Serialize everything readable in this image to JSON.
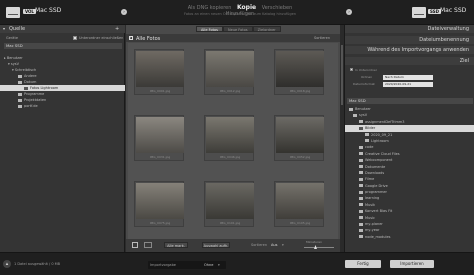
{
  "topbar": {
    "source_badge": "VOL",
    "source_drive": "Mac SSD",
    "dest_badge": "SSD",
    "dest_drive": "Mac SSD",
    "modes": [
      "Als DNG kopieren",
      "Kopie",
      "Verschieben",
      "Hinzufügen"
    ],
    "active_mode": "Kopie",
    "subtitle": "Fotos an einen neuen Ort kopieren und zum Katalog hinzufügen"
  },
  "left_panel": {
    "header": "Quelle",
    "option_label": "Geräte",
    "option_check": "Unterordner einschließen",
    "drive": "Mac SSD",
    "tree": [
      "Benutzer",
      "sysV",
      "Schreibtisch",
      "Andere",
      "Dokum",
      "Fotos Lightroom",
      "Programme",
      "Projektdaten",
      "portf.de"
    ]
  },
  "center": {
    "tabs": [
      "Alle Fotos",
      "Neue Fotos",
      "Ziel­ordner"
    ],
    "header_label": "Alle Fotos",
    "sort_label": "Sortieren",
    "photos": [
      {
        "name": "IMG_0001.jpg",
        "c1": "#6f6a63",
        "c2": "#3b3a37"
      },
      {
        "name": "IMG_0012.jpg",
        "c1": "#7b7870",
        "c2": "#4a4844"
      },
      {
        "name": "IMG_0018.jpg",
        "c1": "#5d5a55",
        "c2": "#2f2e2c"
      },
      {
        "name": "IMG_0031.jpg",
        "c1": "#8b8780",
        "c2": "#4d4b47"
      },
      {
        "name": "IMG_0046.jpg",
        "c1": "#7a776f",
        "c2": "#3e3d39"
      },
      {
        "name": "IMG_0052.jpg",
        "c1": "#6c6a65",
        "c2": "#34332f"
      },
      {
        "name": "IMG_0075.jpg",
        "c1": "#858179",
        "c2": "#4b4944"
      },
      {
        "name": "IMG_0101.jpg",
        "c1": "#6a6862",
        "c2": "#3a3935"
      },
      {
        "name": "IMG_0105.jpg",
        "c1": "#75726b",
        "c2": "#403e3a"
      }
    ],
    "bottom": {
      "check_all": "Alle mark.",
      "uncheck_all": "Auswahl aufh.",
      "sort": "Sortieren",
      "sort_value": "Aus",
      "thumb_label": "Miniaturen"
    }
  },
  "right_panel": {
    "sections": [
      "Dateiverwaltung",
      "Dateiumbenennung",
      "Während des Importvorgangs anwenden",
      "Ziel"
    ],
    "in_subfolder": "In Unterordner",
    "organize_label": "Ordnen",
    "organize_value": "Nach Datum",
    "date_format_label": "Datumsformat",
    "date_format_value": "2020/2020-09-21",
    "drive": "Mac SSD",
    "tree": [
      "Benutzer",
      "sysV",
      "assignmentDefTrimm3",
      "Bilder",
      "2020_09_21",
      "Lightroom",
      "code",
      "Creative Cloud Files",
      "Webcomponent",
      "Dokumente",
      "Downloads",
      "Filme",
      "Google Drive",
      "programmer",
      "learning",
      "Musik",
      "Konvert Bias Fit",
      "Music",
      "my-planer",
      "my-year",
      "node_modules"
    ]
  },
  "bottombar": {
    "left_text": "1 Datei ausgewählt / 0 MB",
    "preset_label": "Importvorgabe",
    "preset_value": "Ohne",
    "done": "Fertig",
    "import": "Importieren"
  }
}
